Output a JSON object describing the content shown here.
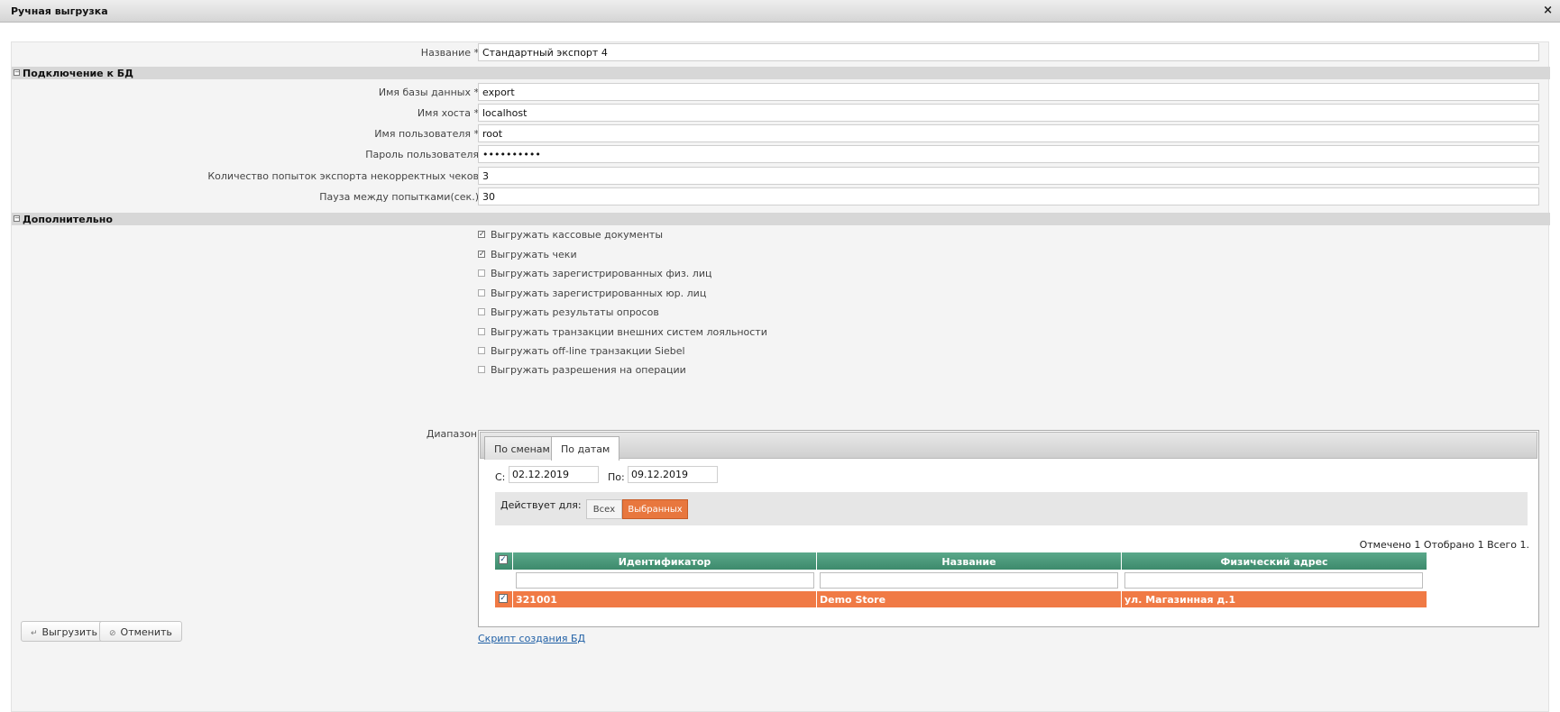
{
  "window": {
    "title": "Ручная выгрузка",
    "close_icon": "×"
  },
  "form": {
    "name_label": "Название *",
    "name_value": "Стандартный экспорт 4"
  },
  "db_section": {
    "title": "Подключение к БД",
    "fields": [
      {
        "label": "Имя базы данных *",
        "value": "export"
      },
      {
        "label": "Имя хоста *",
        "value": "localhost"
      },
      {
        "label": "Имя пользователя *",
        "value": "root"
      },
      {
        "label": "Пароль пользователя",
        "value": "••••••••••"
      },
      {
        "label": "Количество попыток экспорта некорректных чеков",
        "value": "3"
      },
      {
        "label": "Пауза между попытками(сек.)",
        "value": "30"
      }
    ]
  },
  "extra_section": {
    "title": "Дополнительно",
    "checkboxes": [
      {
        "label": "Выгружать кассовые документы",
        "checked": true
      },
      {
        "label": "Выгружать чеки",
        "checked": true
      },
      {
        "label": "Выгружать зарегистрированных физ. лиц",
        "checked": false
      },
      {
        "label": "Выгружать зарегистрированных юр. лиц",
        "checked": false
      },
      {
        "label": "Выгружать результаты опросов",
        "checked": false
      },
      {
        "label": "Выгружать транзакции внешних систем лояльности",
        "checked": false
      },
      {
        "label": "Выгружать off-line транзакции Siebel",
        "checked": false
      },
      {
        "label": "Выгружать разрешения на операции",
        "checked": false
      }
    ]
  },
  "range": {
    "label": "Диапазон",
    "tabs": [
      {
        "label": "По сменам",
        "active": false
      },
      {
        "label": "По датам",
        "active": true
      }
    ],
    "from_label": "С:",
    "from_value": "02.12.2019",
    "to_label": "По:",
    "to_value": "09.12.2019",
    "applies_label": "Действует для:",
    "applies_options": [
      "Всех",
      "Выбранных"
    ],
    "applies_selected": "Выбранных",
    "counts": "Отмечено 1 Отобрано 1 Всего 1.",
    "grid": {
      "columns": [
        "Идентификатор",
        "Название",
        "Физический адрес"
      ],
      "rows": [
        {
          "checked": true,
          "cells": [
            "321001",
            "Demo Store",
            "ул. Магазинная д.1"
          ]
        }
      ]
    }
  },
  "script_link": "Скрипт создания БД",
  "buttons": {
    "export": "Выгрузить",
    "cancel": "Отменить"
  },
  "colors": {
    "grid_header": "#4a9a7b",
    "selected_row": "#f07a45",
    "selected_segment": "#e8773e",
    "link": "#1f5fa5"
  }
}
